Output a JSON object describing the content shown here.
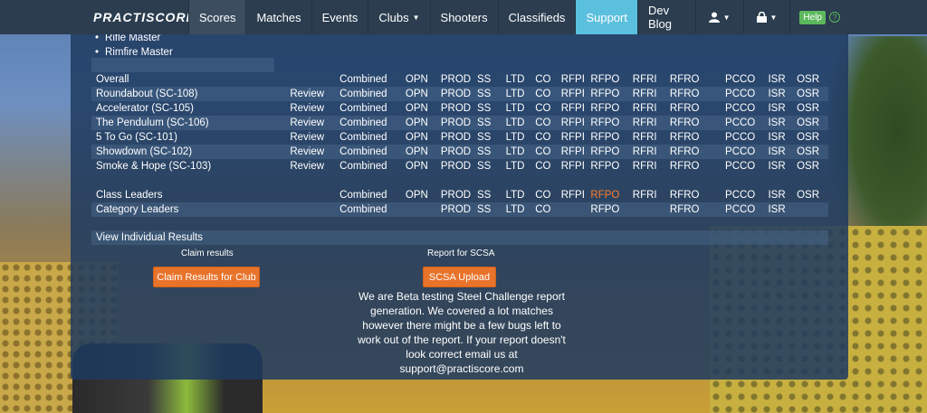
{
  "nav": {
    "brand": "PRACTISCORE",
    "items": [
      {
        "label": "Scores"
      },
      {
        "label": "Matches"
      },
      {
        "label": "Events"
      },
      {
        "label": "Clubs"
      },
      {
        "label": "Shooters"
      },
      {
        "label": "Classifieds"
      },
      {
        "label": "Support"
      },
      {
        "label": "Dev Blog"
      }
    ],
    "help_label": "Help",
    "help_q": "?"
  },
  "bullets": [
    "Rifle Master",
    "Rimfire Master"
  ],
  "table": {
    "overall": {
      "name": "Overall",
      "combined": "Combined",
      "classes": [
        "OPN",
        "PROD",
        "SS",
        "LTD",
        "CO",
        "RFPI",
        "RFPO",
        "RFRI",
        "RFRO",
        "PCCO",
        "ISR",
        "OSR"
      ]
    },
    "stages": [
      {
        "name": "Roundabout (SC-108)",
        "review": "Review",
        "combined": "Combined"
      },
      {
        "name": "Accelerator (SC-105)",
        "review": "Review",
        "combined": "Combined"
      },
      {
        "name": "The Pendulum (SC-106)",
        "review": "Review",
        "combined": "Combined"
      },
      {
        "name": "5 To Go (SC-101)",
        "review": "Review",
        "combined": "Combined"
      },
      {
        "name": "Showdown (SC-102)",
        "review": "Review",
        "combined": "Combined"
      },
      {
        "name": "Smoke & Hope (SC-103)",
        "review": "Review",
        "combined": "Combined"
      }
    ],
    "stage_classes": [
      "OPN",
      "PROD",
      "SS",
      "LTD",
      "CO",
      "RFPI",
      "RFPO",
      "RFRI",
      "RFRO",
      "PCCO",
      "ISR",
      "OSR"
    ],
    "class_leaders": {
      "name": "Class Leaders",
      "combined": "Combined",
      "classes": [
        "OPN",
        "PROD",
        "SS",
        "LTD",
        "CO",
        "RFPI",
        "RFPO",
        "RFRI",
        "RFRO",
        "PCCO",
        "ISR",
        "OSR"
      ],
      "highlight_color": "#ff7b2a"
    },
    "category_leaders": {
      "name": "Category Leaders",
      "combined": "Combined",
      "classes": [
        "",
        "PROD",
        "SS",
        "LTD",
        "CO",
        "",
        "RFPO",
        "",
        "RFRO",
        "PCCO",
        "ISR",
        ""
      ]
    },
    "view_individual": "View Individual Results"
  },
  "claim": {
    "label": "Claim results",
    "button": "Claim Results for Club"
  },
  "report": {
    "label": "Report for SCSA",
    "button": "SCSA Upload"
  },
  "beta_text": "We are Beta testing Steel Challenge report generation. We covered a lot matches however there might be a few bugs left to work out of the report. If your report doesn't look correct email us at support@practiscore.com",
  "colors": {
    "navbar": "#2b3d4f",
    "active_tab": "#5bc0de",
    "accent_orange": "#e8732a",
    "help_green": "#5cb85c"
  }
}
